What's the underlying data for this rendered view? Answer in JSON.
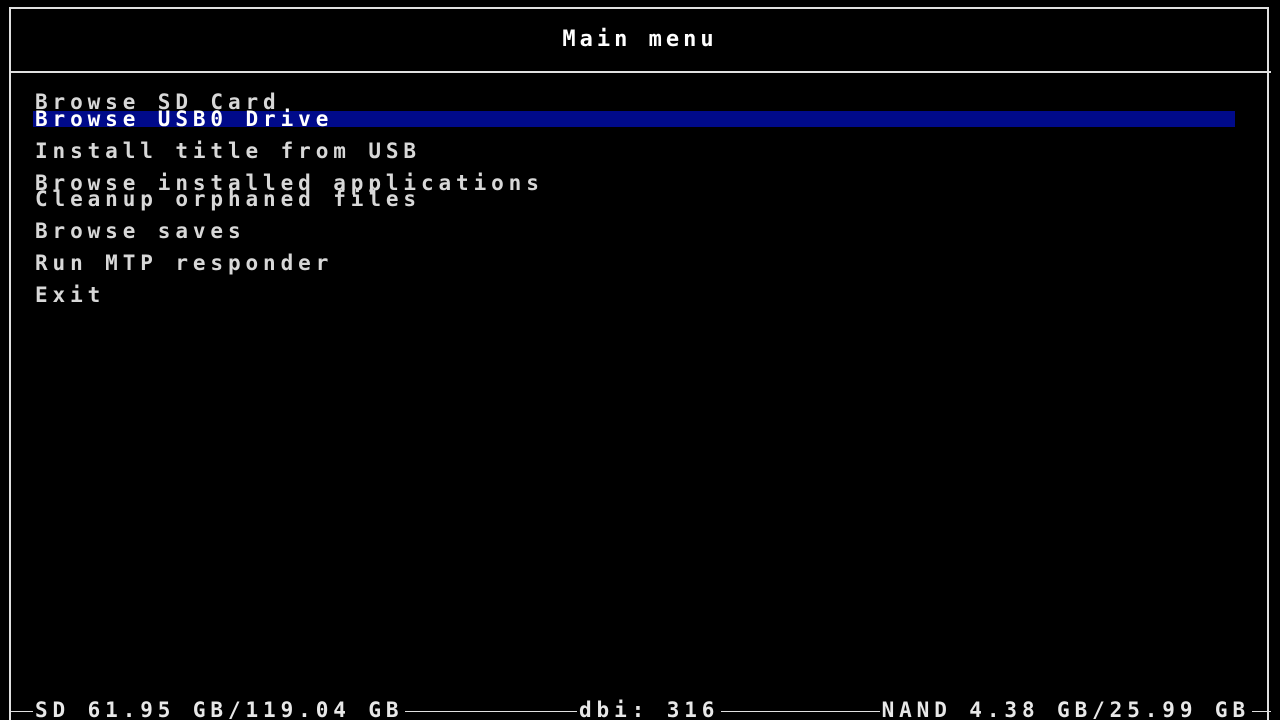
{
  "header": {
    "title": "Main menu"
  },
  "menu": {
    "selected_index": 1,
    "items": [
      {
        "label": "Browse SD Card"
      },
      {
        "label": "Browse USB0 Drive"
      },
      {
        "label": "Install title from USB"
      },
      {
        "label": "Browse installed applications"
      },
      {
        "label": "Cleanup orphaned files"
      },
      {
        "label": "Browse saves"
      },
      {
        "label": "Run MTP responder"
      },
      {
        "label": "Exit"
      }
    ]
  },
  "footer": {
    "sd_storage": "SD 61.95 GB/119.04 GB",
    "app_version": "dbi: 316",
    "nand_storage": "NAND 4.38 GB/25.99 GB"
  },
  "colors": {
    "background": "#000000",
    "text": "#d8d8d8",
    "selection": "#000a8a",
    "border": "#e0e0e0"
  }
}
